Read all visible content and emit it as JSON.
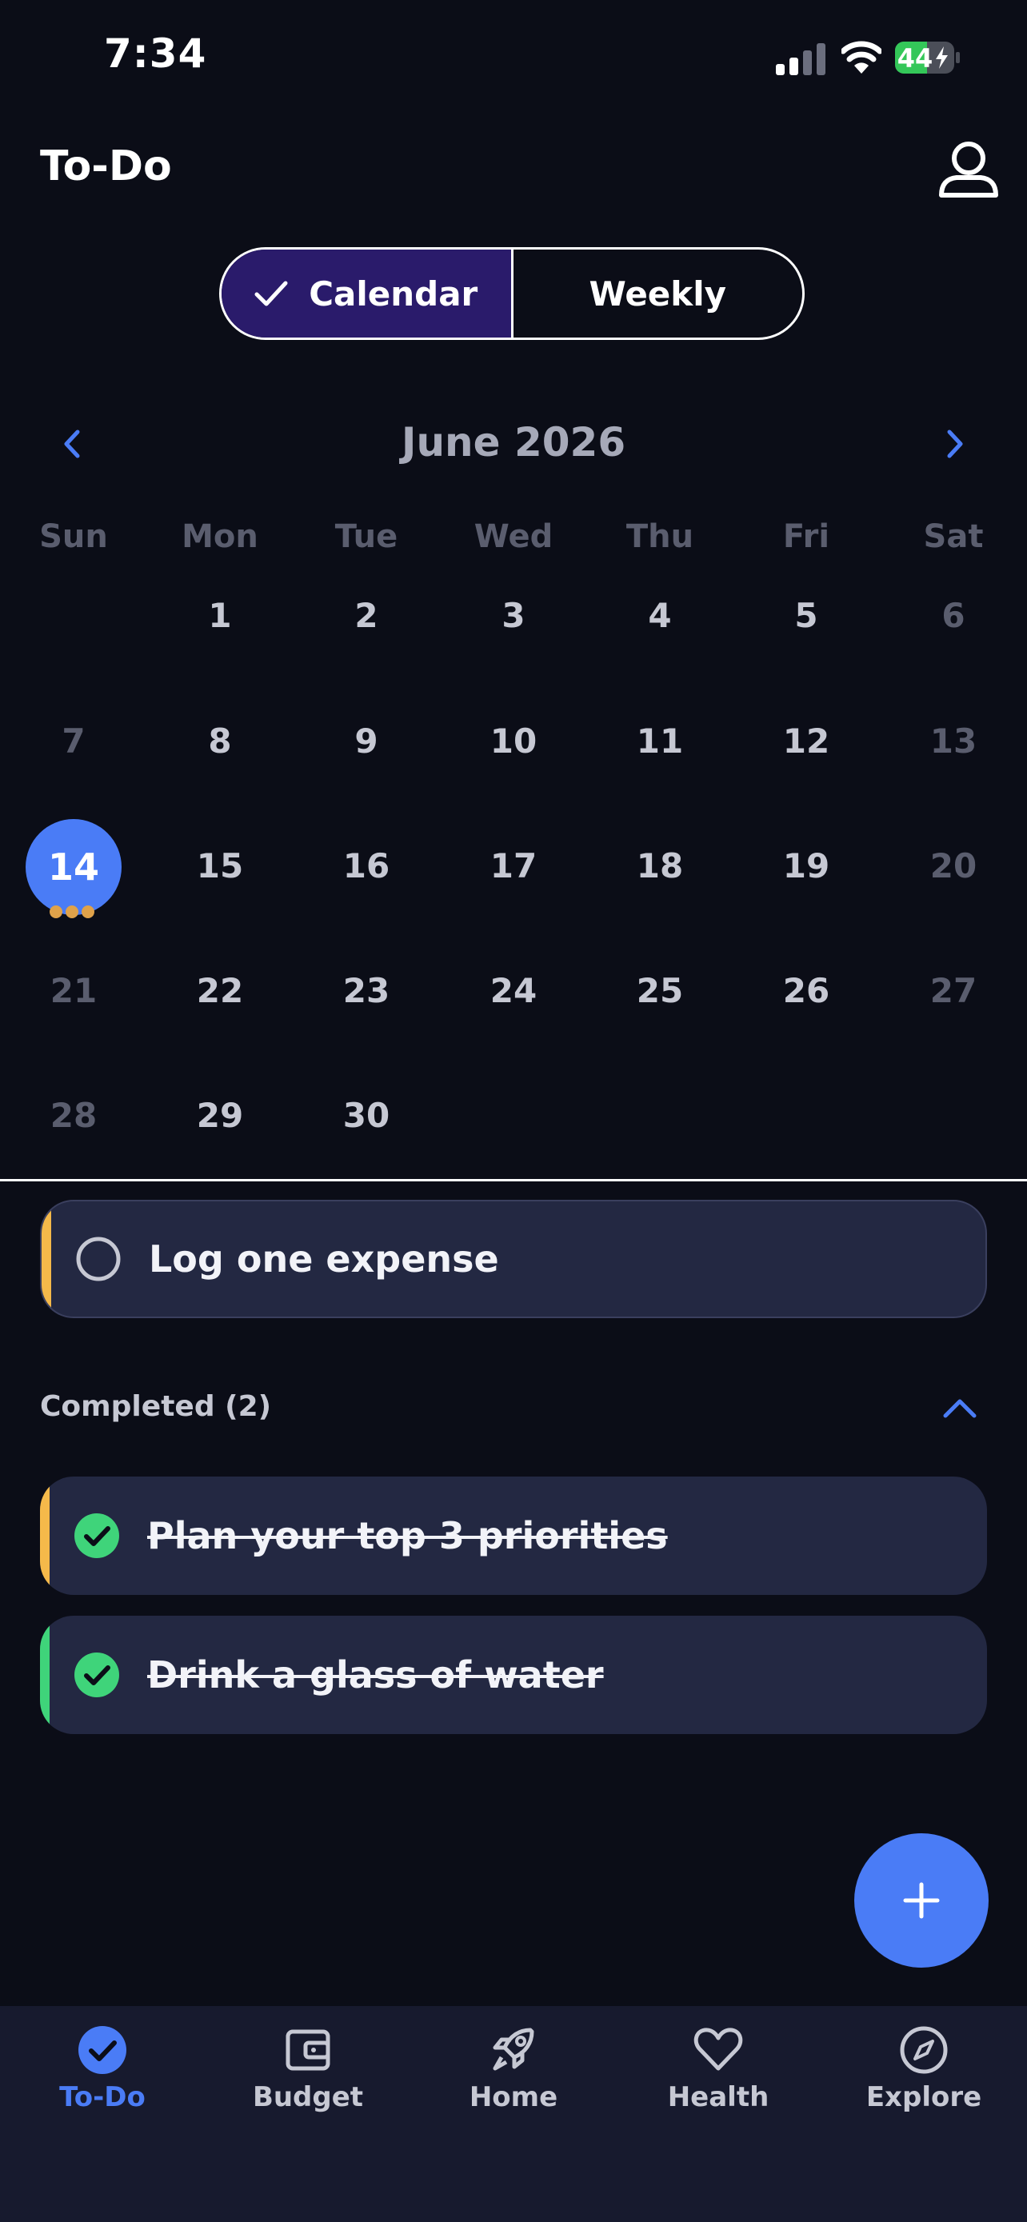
{
  "status_bar": {
    "time": "7:34",
    "battery": "44"
  },
  "header": {
    "title": "To-Do"
  },
  "view_toggle": {
    "options": [
      "Calendar",
      "Weekly"
    ],
    "selected": "Calendar"
  },
  "calendar": {
    "month_label": "June 2026",
    "weekdays": [
      "Sun",
      "Mon",
      "Tue",
      "Wed",
      "Thu",
      "Fri",
      "Sat"
    ],
    "weeks": [
      [
        "",
        "1",
        "2",
        "3",
        "4",
        "5",
        "6"
      ],
      [
        "7",
        "8",
        "9",
        "10",
        "11",
        "12",
        "13"
      ],
      [
        "14",
        "15",
        "16",
        "17",
        "18",
        "19",
        "20"
      ],
      [
        "21",
        "22",
        "23",
        "24",
        "25",
        "26",
        "27"
      ],
      [
        "28",
        "29",
        "30",
        "",
        "",
        "",
        ""
      ]
    ],
    "selected_day": "14"
  },
  "tasks": {
    "pending": [
      {
        "label": "Log one expense",
        "accent": "#f5b94a"
      }
    ],
    "completed_label": "Completed (2)",
    "completed": [
      {
        "label": "Plan your top 3 priorities",
        "accent": "#f5b94a"
      },
      {
        "label": "Drink a glass of water",
        "accent": "#3fd47a"
      }
    ]
  },
  "tab_bar": {
    "items": [
      {
        "label": "To-Do",
        "icon": "check-circle-icon",
        "active": true
      },
      {
        "label": "Budget",
        "icon": "wallet-icon",
        "active": false
      },
      {
        "label": "Home",
        "icon": "rocket-icon",
        "active": false
      },
      {
        "label": "Health",
        "icon": "heart-icon",
        "active": false
      },
      {
        "label": "Explore",
        "icon": "compass-icon",
        "active": false
      }
    ]
  },
  "colors": {
    "accent": "#4a7cf6",
    "background": "#0b0d17",
    "card": "#232842",
    "segment_active": "#2a1b6b",
    "success": "#3fd47a",
    "battery_green": "#34c759"
  }
}
